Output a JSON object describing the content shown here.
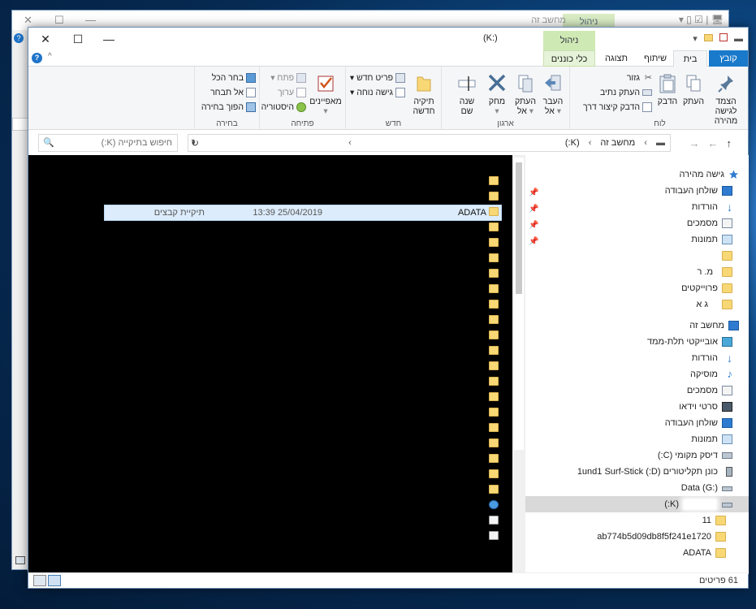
{
  "back_window": {
    "title": "מחשב זה",
    "manage": "ניהול",
    "close": "✕",
    "maximize": "☐",
    "minimize": "—",
    "help": "?"
  },
  "window": {
    "title": "(K:)",
    "close": "✕",
    "maximize": "☐",
    "minimize": "—",
    "manage_label": "ניהול",
    "tabs": {
      "file": "קובץ",
      "home": "בית",
      "share": "שיתוף",
      "view": "תצוגה",
      "disk_tools": "כלי כוננים"
    },
    "help": "?",
    "collapse": "^"
  },
  "ribbon": {
    "clipboard": {
      "name": "לוח",
      "pin": "הצמד לגישה מהירה",
      "copy": "העתק",
      "paste": "הדבק",
      "cut": "גזור",
      "copy_path": "העתק נתיב",
      "paste_shortcut": "הדבק קיצור דרך"
    },
    "organize": {
      "name": "ארגון",
      "move_to": "העבר אל",
      "copy_to": "העתק אל",
      "delete": "מחק",
      "rename": "שנה שם"
    },
    "new": {
      "name": "חדש",
      "new_folder": "תיקיה חדשה",
      "new_item": "פריט חדש",
      "easy_access": "גישה נוחה"
    },
    "open": {
      "name": "פתיחה",
      "properties": "מאפיינים",
      "open": "פתח",
      "edit": "ערוך",
      "history": "היסטוריה"
    },
    "select": {
      "name": "בחירה",
      "select_all": "בחר הכל",
      "select_none": "אל תבחר",
      "invert": "הפוך בחירה"
    }
  },
  "address": {
    "pc": "מחשב זה",
    "drive": "(K:)",
    "search_placeholder": "חיפוש בתיקייה (K:)"
  },
  "content": {
    "selected_row": {
      "name": "ADATA",
      "date": "25/04/2019 13:39",
      "type": "תיקיית קבצים"
    }
  },
  "navpane": {
    "quick_access": "גישה מהירה",
    "items_quick": [
      "שולחן העבודה",
      "הורדות",
      "מסמכים",
      "תמונות"
    ],
    "masked_a": "מ. ר",
    "projects": "פרוייקטים",
    "masked_b": "ג א",
    "this_pc": "מחשב זה",
    "pc_items": [
      "אובייקטי תלת-ממד",
      "הורדות",
      "מוסיקה",
      "מסמכים",
      "סרטי וידאו",
      "שולחן העבודה",
      "תמונות"
    ],
    "local_disk": "דיסק מקומי (C:)",
    "stick": "כונן תקליטורים (D:) 1und1 Surf-Stick",
    "data_g": "Data (G:)",
    "k_drive": "(K:)",
    "k_children": [
      "11",
      "ab774b5d09db8f5f241e1720",
      "ADATA"
    ]
  },
  "status": {
    "count": "61 פריטים"
  },
  "colors": {
    "file_tab": "#1979ca",
    "manage": "#cfe9b4",
    "selection": "#dcecfc",
    "folder": "#f8d775"
  }
}
